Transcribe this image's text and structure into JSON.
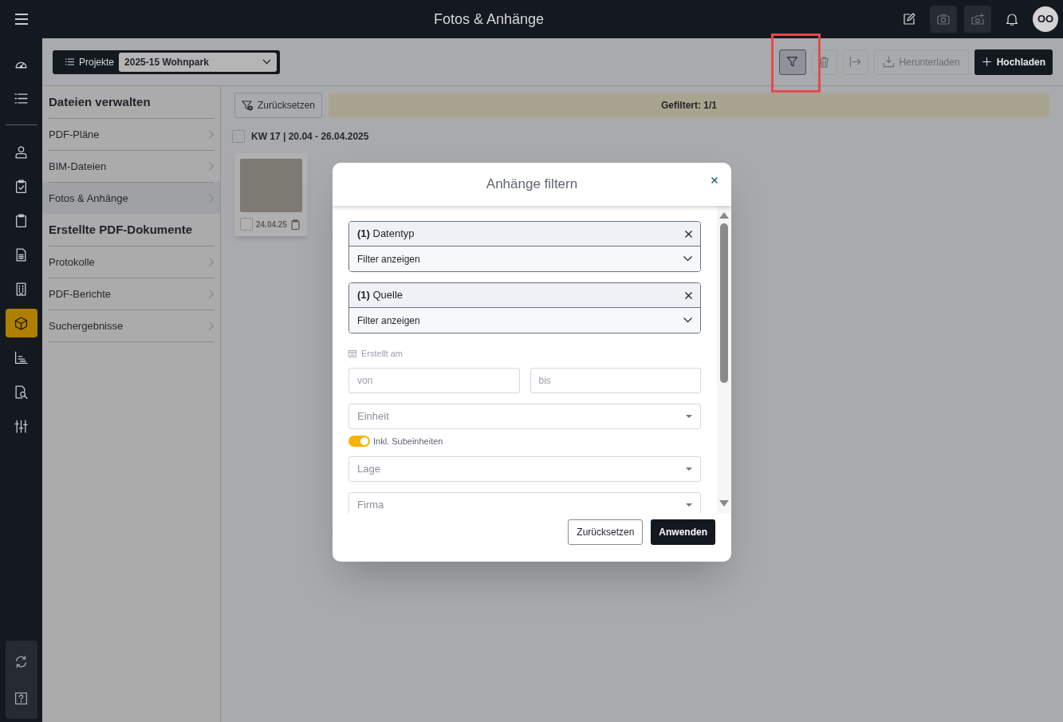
{
  "window": {
    "title": "Fotos & Anhänge"
  },
  "header_actions": [
    {
      "kind": "edit",
      "disabled": false
    },
    {
      "kind": "camera",
      "disabled": true
    },
    {
      "kind": "camera-plus",
      "disabled": true
    },
    {
      "kind": "bell",
      "disabled": false
    }
  ],
  "avatar": {
    "initials": "OO"
  },
  "rail": [
    {
      "kind": "gauge",
      "selected": false
    },
    {
      "kind": "list",
      "selected": false
    },
    {
      "kind": "user",
      "selected": false
    },
    {
      "kind": "clipboard-check",
      "selected": false
    },
    {
      "kind": "clipboard",
      "selected": false
    },
    {
      "kind": "document",
      "selected": false
    },
    {
      "kind": "building",
      "selected": false
    },
    {
      "kind": "box",
      "selected": true
    },
    {
      "kind": "chart",
      "selected": false
    },
    {
      "kind": "doc-search",
      "selected": false
    },
    {
      "kind": "sliders",
      "selected": false
    }
  ],
  "rail_bottom": [
    {
      "kind": "sync"
    },
    {
      "kind": "help"
    }
  ],
  "project_selector": {
    "label": "Projekte",
    "value": "2025-15 Wohnpark"
  },
  "toolbar": [
    {
      "kind": "filter",
      "active": true
    },
    {
      "kind": "trash",
      "disabled": true
    },
    {
      "kind": "export",
      "disabled": true
    },
    {
      "kind": "download",
      "label": "Herunterladen",
      "disabled": true
    },
    {
      "kind": "upload",
      "label": "Hochladen",
      "primary": true
    }
  ],
  "sidebar": [
    {
      "title": "Dateien verwalten",
      "items": [
        {
          "label": "PDF-Pläne",
          "selected": false
        },
        {
          "label": "BIM-Dateien",
          "selected": false
        },
        {
          "label": "Fotos & Anhänge",
          "selected": true
        }
      ]
    },
    {
      "title": "Erstellte PDF-Dokumente",
      "items": [
        {
          "label": "Protokolle",
          "selected": false
        },
        {
          "label": "PDF-Berichte",
          "selected": false
        },
        {
          "label": "Suchergebnisse",
          "selected": false
        }
      ]
    }
  ],
  "reset_button": "Zurücksetzen",
  "filter_banner": "Gefiltert: 1/1",
  "groups": [
    {
      "label": "KW 17 | 20.04 - 26.04.2025",
      "checked": false,
      "photos": [
        {
          "date": "24.04.25",
          "checked": false
        }
      ]
    }
  ],
  "modal": {
    "title": "Anhänge filtern",
    "filters": [
      {
        "name": "**(1)** Datentyp",
        "action": "Filter anzeigen"
      },
      {
        "name": "**(1)** Quelle",
        "action": "Filter anzeigen"
      }
    ],
    "date": {
      "label": "Erstellt am",
      "from": {
        "placeholder": "von"
      },
      "to": {
        "placeholder": "bis"
      }
    },
    "fields": [
      {
        "kind": "select",
        "placeholder": "Einheit"
      },
      {
        "kind": "toggle",
        "label": "Inkl. Subeinheiten",
        "on": true
      },
      {
        "kind": "select",
        "placeholder": "Lage"
      },
      {
        "kind": "select",
        "placeholder": "Firma"
      }
    ],
    "buttons": [
      {
        "label": "Zurücksetzen",
        "primary": false
      },
      {
        "label": "Anwenden",
        "primary": true
      }
    ]
  }
}
